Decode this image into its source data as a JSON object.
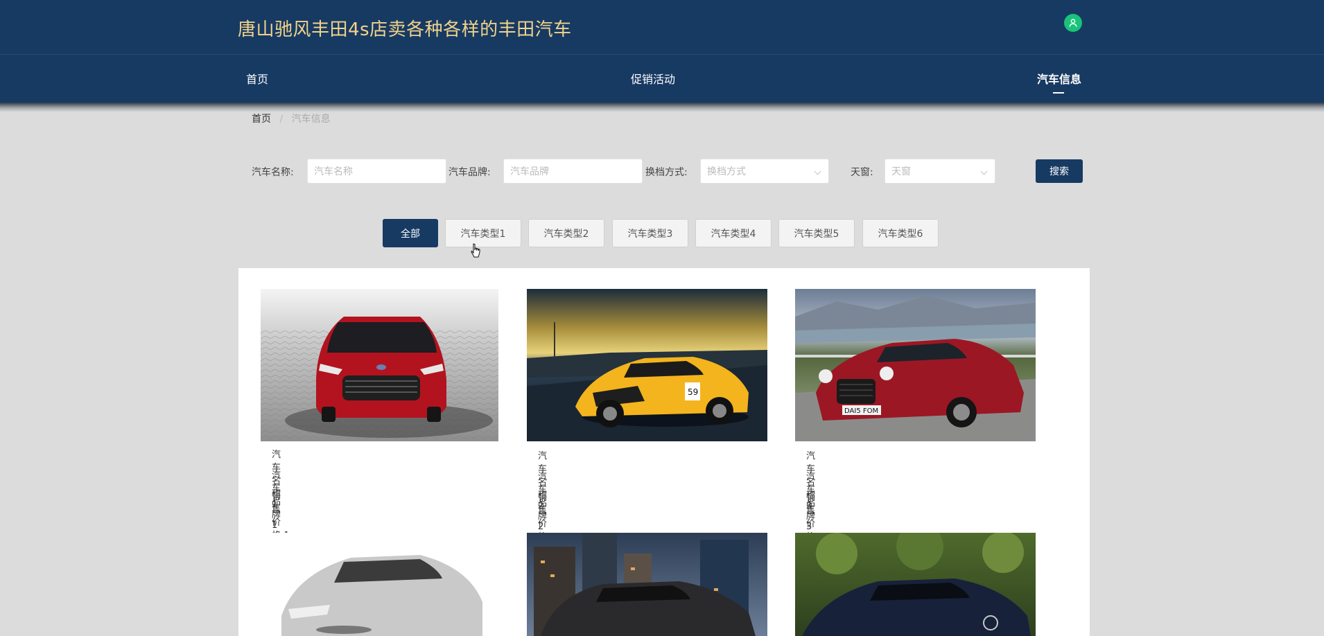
{
  "header": {
    "title": "唐山驰风丰田4s店卖各种各样的丰田汽车",
    "user_icon": "user-icon"
  },
  "nav": {
    "items": [
      {
        "label": "首页"
      },
      {
        "label": "促销活动"
      },
      {
        "label": "汽车信息"
      }
    ],
    "active": "汽车信息"
  },
  "breadcrumb": {
    "home": "首页",
    "separator": "/",
    "current": "汽车信息"
  },
  "search": {
    "name_label": "汽车名称:",
    "name_placeholder": "汽车名称",
    "brand_label": "汽车品牌:",
    "brand_placeholder": "汽车品牌",
    "gear_label": "换档方式:",
    "gear_placeholder": "换档方式",
    "sunroof_label": "天窗:",
    "sunroof_placeholder": "天窗",
    "button_label": "搜索"
  },
  "categories": [
    "全部",
    "汽车类型1",
    "汽车类型2",
    "汽车类型3",
    "汽车类型4",
    "汽车类型5",
    "汽车类型6"
  ],
  "cars": [
    {
      "name": "汽车名称1",
      "brand": "汽车品牌1",
      "price_label": "销售价格:",
      "price": "1"
    },
    {
      "name": "汽车名称2",
      "brand": "汽车品牌2",
      "price_label": "销售价格:",
      "price": "2"
    },
    {
      "name": "汽车名称3",
      "brand": "汽车品牌3",
      "price_label": "销售价格:",
      "price": "3"
    }
  ],
  "colors": {
    "primary": "#173a63",
    "title_gold": "#f2d38a",
    "user_green": "#19c37a"
  }
}
